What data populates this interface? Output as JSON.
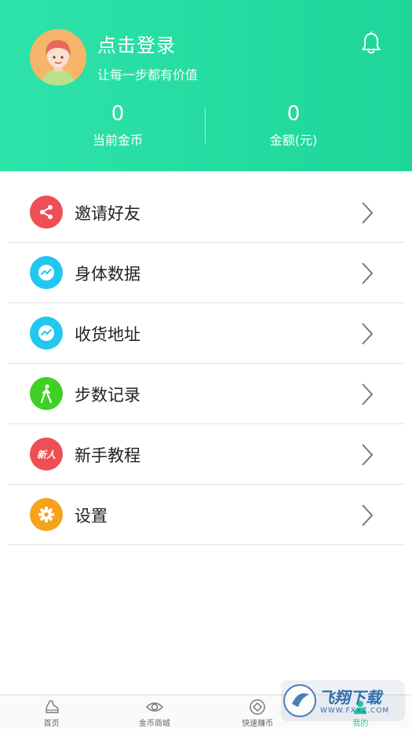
{
  "header": {
    "login_title": "点击登录",
    "login_subtitle": "让每一步都有价值",
    "bell_icon": "bell-icon",
    "stats": [
      {
        "value": "0",
        "label": "当前金币"
      },
      {
        "value": "0",
        "label": "金额(元)"
      }
    ]
  },
  "menu": [
    {
      "label": "邀请好友",
      "icon": "share-icon",
      "color": "#ef4e54"
    },
    {
      "label": "身体数据",
      "icon": "chart-icon",
      "color": "#22c7ef"
    },
    {
      "label": "收货地址",
      "icon": "chart-icon",
      "color": "#22c7ef"
    },
    {
      "label": "步数记录",
      "icon": "walking-icon",
      "color": "#3ed024"
    },
    {
      "label": "新手教程",
      "icon": "newbie-icon",
      "color": "#ef4e54",
      "icon_text": "新人"
    },
    {
      "label": "设置",
      "icon": "gear-icon",
      "color": "#f7a21b"
    }
  ],
  "tabs": [
    {
      "label": "首页",
      "icon": "shoe-icon",
      "active": false
    },
    {
      "label": "金币商城",
      "icon": "eye-icon",
      "active": false
    },
    {
      "label": "快速赚币",
      "icon": "coin-icon",
      "active": false
    },
    {
      "label": "我的",
      "icon": "person-icon",
      "active": true
    }
  ],
  "watermark": {
    "text": "飞翔下载",
    "url_text": "WWW.FXXZ.COM"
  },
  "colors": {
    "accent": "#1fd59a",
    "header_start": "#2ee3a9"
  }
}
